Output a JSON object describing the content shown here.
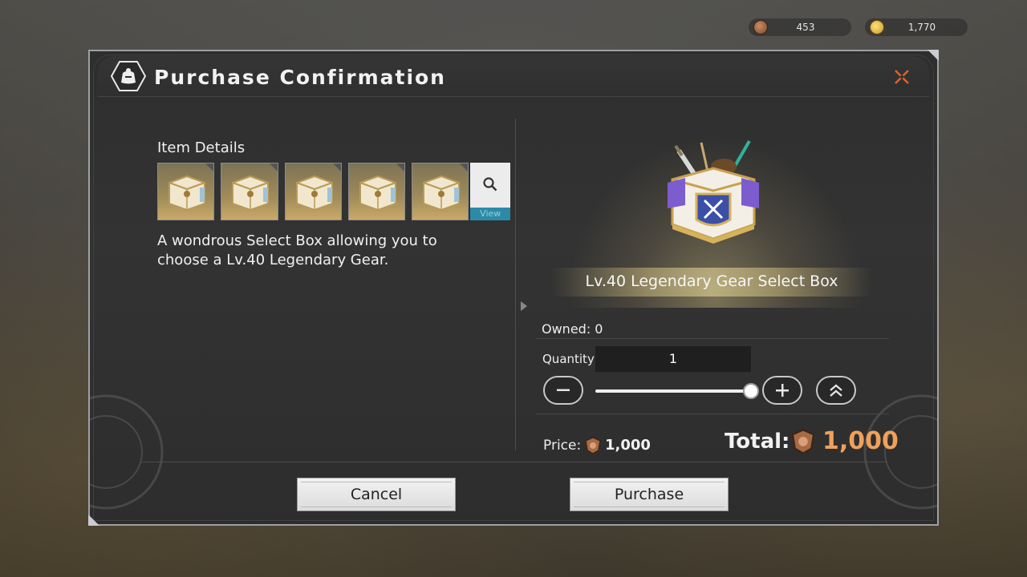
{
  "currency": [
    {
      "icon": "bronze-coin-icon",
      "value": "453"
    },
    {
      "icon": "gold-coin-icon",
      "value": "1,770"
    }
  ],
  "dialog": {
    "title": "Purchase Confirmation",
    "item_details_label": "Item Details",
    "view_label": "View",
    "description": "A wondrous Select Box allowing you to choose a Lv.40 Legendary Gear.",
    "item_count": 5
  },
  "product": {
    "name": "Lv.40 Legendary Gear Select Box",
    "owned": "Owned: 0",
    "quantity_label": "Quantity",
    "quantity": "1",
    "slider_fraction": 1.0,
    "price_label": "Price:",
    "price": "1,000",
    "total_label": "Total:",
    "total": "1,000"
  },
  "buttons": {
    "cancel": "Cancel",
    "purchase": "Purchase"
  },
  "colors": {
    "total_accent": "#f0a05a",
    "view_bar": "#2c8aa6",
    "close_icon": "#e0622a"
  }
}
